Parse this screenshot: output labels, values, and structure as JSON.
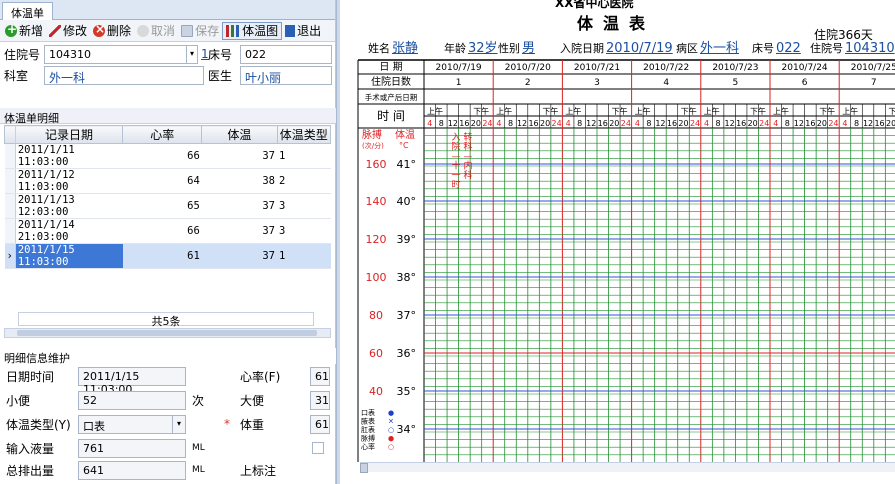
{
  "tab": "体温单",
  "toolbar": [
    {
      "label": "新增",
      "icon": "add-icon",
      "disabled": false
    },
    {
      "label": "修改",
      "icon": "edit-icon",
      "disabled": false
    },
    {
      "label": "删除",
      "icon": "delete-icon",
      "disabled": false
    },
    {
      "label": "取消",
      "icon": "cancel-icon",
      "disabled": true
    },
    {
      "label": "保存",
      "icon": "save-icon",
      "disabled": true
    },
    {
      "label": "体温图",
      "icon": "chart-icon",
      "disabled": false,
      "active": true
    },
    {
      "label": "退出",
      "icon": "exit-icon",
      "disabled": false
    }
  ],
  "patient": {
    "hosp_no_label": "住院号",
    "hosp_no": "104310",
    "hosp_no_btn": "1",
    "bed_label": "床号",
    "bed": "022",
    "dept_label": "科室",
    "dept": "外一科",
    "doctor_label": "医生",
    "doctor": "叶小丽"
  },
  "detail_section": "体温单明细",
  "table": {
    "columns": [
      "记录日期",
      "心率",
      "体温",
      "体温类型"
    ],
    "rows": [
      {
        "date": "2011/1/11 11:03:00",
        "hr": "66",
        "temp": "37",
        "type": "1"
      },
      {
        "date": "2011/1/12 11:03:00",
        "hr": "64",
        "temp": "38",
        "type": "2"
      },
      {
        "date": "2011/1/13 12:03:00",
        "hr": "65",
        "temp": "37",
        "type": "3"
      },
      {
        "date": "2011/1/14 21:03:00",
        "hr": "66",
        "temp": "37",
        "type": "3"
      },
      {
        "date": "2011/1/15 11:03:00",
        "hr": "61",
        "temp": "37",
        "type": "1"
      }
    ],
    "footer": "共5条"
  },
  "maint_section": "明细信息维护",
  "form": {
    "datetime_label": "日期时间",
    "datetime": "2011/1/15 11:03:00",
    "hr_label": "心率(F)",
    "hr": "61",
    "urine_label": "小便",
    "urine": "52",
    "urine_unit": "次",
    "stool_label": "大便",
    "stool": "31",
    "type_label": "体温类型(Y)",
    "type": "口表",
    "weight_label": "体重",
    "weight": "61",
    "required_mark": "*",
    "intake_label": "输入液量",
    "intake": "761",
    "intake_unit": "ML",
    "output_label": "总排出量",
    "output": "641",
    "output_unit": "ML",
    "mark_label": "上标注"
  },
  "sheet": {
    "hospital": "XX省中心医院",
    "title": "体温表",
    "days": "住院366天",
    "name_label": "姓名",
    "name": "张静",
    "age_label": "年龄",
    "age": "32岁",
    "sex_label": "性别",
    "sex": "男",
    "admit_label": "入院日期",
    "admit": "2010/7/19",
    "ward_label": "病区",
    "ward": "外一科",
    "bed_label": "床号",
    "bed": "022",
    "hosp_label": "住院号",
    "hosp": "104310",
    "row_date": "日 期",
    "row_days": "住院日数",
    "row_surg": "手术或产后日期",
    "row_time": "时 间",
    "am": "上午",
    "pm": "下午",
    "hours": [
      "4",
      "8",
      "12",
      "16",
      "20",
      "24"
    ],
    "dates": [
      "2010/7/19",
      "2010/7/20",
      "2010/7/21",
      "2010/7/22",
      "2010/7/23",
      "2010/7/24",
      "2010/7/25"
    ],
    "day_nums": [
      "1",
      "2",
      "3",
      "4",
      "5",
      "6",
      "7"
    ],
    "pulse_hdr": "脉搏",
    "pulse_unit": "(次/分)",
    "temp_hdr": "体温",
    "temp_unit": "°C",
    "pulse_labels": [
      "160",
      "140",
      "120",
      "100",
      "80",
      "60",
      "40"
    ],
    "temp_labels": [
      "41°",
      "40°",
      "39°",
      "38°",
      "37°",
      "36°",
      "35°",
      "34°"
    ],
    "note_admit": "入院—十一时",
    "note_transfer": "转科—内科",
    "legend": [
      "口表",
      "腋表",
      "肛表",
      "脉搏",
      "心率"
    ]
  }
}
